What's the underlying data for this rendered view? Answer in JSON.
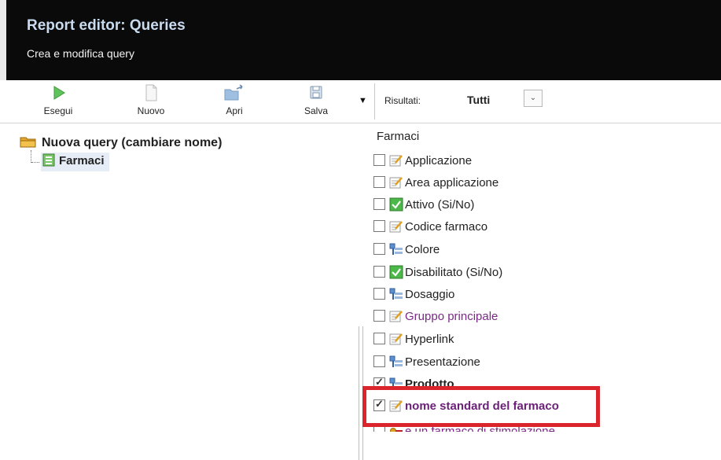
{
  "header": {
    "title": "Report editor: Queries",
    "subtitle": "Crea e modifica query"
  },
  "toolbar": {
    "buttons": [
      {
        "label": "Esegui",
        "icon": "play-icon"
      },
      {
        "label": "Nuovo",
        "icon": "new-document-icon"
      },
      {
        "label": "Apri",
        "icon": "open-folder-icon"
      },
      {
        "label": "Salva",
        "icon": "save-icon"
      }
    ],
    "dropdown_icon": "caret-down-icon",
    "results_label": "Risultati:",
    "results_value": "Tutti"
  },
  "tree": {
    "root_label": "Nuova query (cambiare nome)",
    "child_label": "Farmaci"
  },
  "fields": {
    "title": "Farmaci",
    "items": [
      {
        "label": "Applicazione",
        "type": "text",
        "checked": false
      },
      {
        "label": "Area applicazione",
        "type": "text",
        "checked": false
      },
      {
        "label": "Attivo (Si/No)",
        "type": "boolean",
        "checked": false
      },
      {
        "label": "Codice farmaco",
        "type": "text",
        "checked": false
      },
      {
        "label": "Colore",
        "type": "lookup",
        "checked": false
      },
      {
        "label": "Disabilitato (Si/No)",
        "type": "boolean",
        "checked": false
      },
      {
        "label": "Dosaggio",
        "type": "lookup",
        "checked": false
      },
      {
        "label": "Gruppo principale",
        "type": "text",
        "checked": false
      },
      {
        "label": "Hyperlink",
        "type": "text",
        "checked": false
      },
      {
        "label": "Presentazione",
        "type": "lookup",
        "checked": false
      },
      {
        "label": "Prodotto",
        "type": "lookup",
        "checked": true
      },
      {
        "label": "nome standard del farmaco",
        "type": "text",
        "checked": true
      },
      {
        "label": "e un farmaco di stimolazione",
        "type": "key",
        "checked": false
      }
    ]
  },
  "colors": {
    "header_bg": "#0a0a0a",
    "header_title": "#c9dbef",
    "highlight_box": "#d9252b",
    "purple_text": "#7a2a86",
    "tree_selection": "#e6edf7"
  }
}
